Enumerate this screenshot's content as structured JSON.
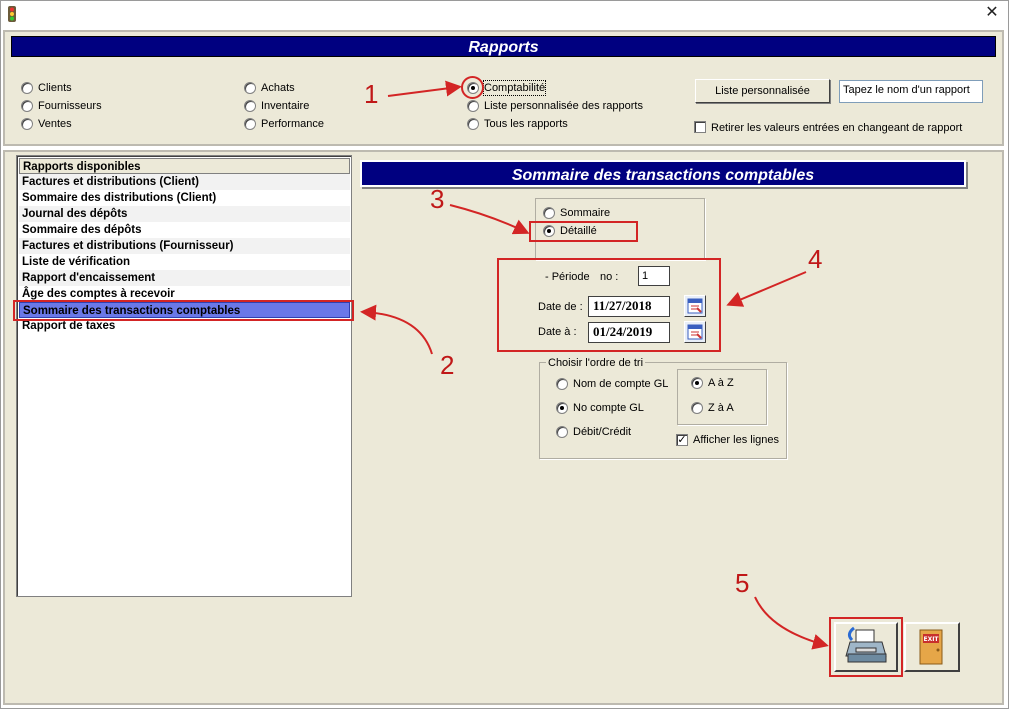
{
  "window": {
    "close_glyph": "✕"
  },
  "header": {
    "title": "Rapports"
  },
  "categories": {
    "col1": [
      "Clients",
      "Fournisseurs",
      "Ventes"
    ],
    "col2": [
      "Achats",
      "Inventaire",
      "Performance"
    ],
    "col3": [
      "Comptabilité",
      "Liste personnalisée des rapports",
      "Tous les rapports"
    ],
    "selected": "Comptabilité"
  },
  "custom_list": {
    "button_label": "Liste personnalisée",
    "name_field_value": "Tapez le nom d'un rapport",
    "reset_checkbox_label": "Retirer les valeurs entrées en changeant de rapport",
    "reset_checked": false
  },
  "report_list": {
    "header": "Rapports disponibles",
    "items": [
      "Factures et distributions (Client)",
      "Sommaire des distributions (Client)",
      "Journal des dépôts",
      "Sommaire des dépôts",
      "Factures et distributions (Fournisseur)",
      "Liste de vérification",
      "Rapport d'encaissement",
      "Âge des comptes à recevoir",
      "Sommaire des transactions comptables",
      "Rapport de taxes"
    ],
    "selected_index": 8
  },
  "report_panel": {
    "title": "Sommaire des transactions comptables",
    "mode_options": [
      "Sommaire",
      "Détaillé"
    ],
    "mode_selected": "Détaillé",
    "period_label": "- Période",
    "period_no_label": "no :",
    "period_value": "1",
    "date_from_label": "Date de :",
    "date_from_value": "11/27/2018",
    "date_to_label": "Date à :",
    "date_to_value": "01/24/2019",
    "sort_group_label": "Choisir l'ordre de tri",
    "sort_options": [
      "Nom de compte GL",
      "No compte GL",
      "Débit/Crédit"
    ],
    "sort_selected": "No compte GL",
    "order_options": [
      "A à Z",
      "Z à A"
    ],
    "order_selected": "A à Z",
    "show_lines_label": "Afficher les lignes",
    "show_lines_checked": true
  },
  "actions": {
    "exit_label": "EXIT"
  },
  "annotations": [
    "1",
    "2",
    "3",
    "4",
    "5"
  ],
  "colors": {
    "banner": "#000080",
    "selection": "#6a78e8",
    "annotation": "#d32525",
    "panel": "#ece9d8"
  }
}
